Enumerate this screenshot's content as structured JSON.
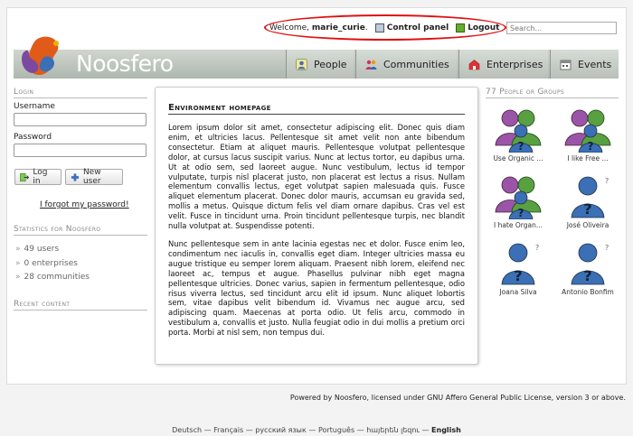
{
  "userbar": {
    "welcome_prefix": "Welcome,",
    "username": "marie_curie",
    "control_panel": "Control panel",
    "logout": "Logout"
  },
  "search": {
    "placeholder": "Search..."
  },
  "site": {
    "name": "Noosfero"
  },
  "nav": {
    "people": "People",
    "communities": "Communities",
    "enterprises": "Enterprises",
    "events": "Events"
  },
  "login": {
    "title": "Login",
    "username_label": "Username",
    "password_label": "Password",
    "login_button": "Log in",
    "new_user_button": "New user",
    "forgot": "I forgot my password!"
  },
  "statistics": {
    "title": "Statistics for Noosfero",
    "items": [
      "49 users",
      "0 enterprises",
      "28 communities"
    ]
  },
  "recent": {
    "title": "Recent content"
  },
  "main": {
    "title": "Environment homepage",
    "p1": "Lorem ipsum dolor sit amet, consectetur adipiscing elit. Donec quis diam enim, et ultricies lacus. Pellentesque sit amet velit non ante bibendum consectetur. Etiam at aliquet mauris. Pellentesque volutpat pellentesque dolor, at cursus lacus suscipit varius. Nunc at lectus tortor, eu dapibus urna. Ut at odio sem, sed laoreet augue. Nunc vestibulum, lectus id tempor vulputate, turpis nisl placerat justo, non placerat est lectus a risus. Nullam elementum convallis lectus, eget volutpat sapien malesuada quis. Fusce aliquet elementum placerat. Donec dolor mauris, accumsan eu gravida sed, mollis a metus. Quisque dictum felis vel diam ornare dapibus. Cras vel est velit. Fusce in tincidunt urna. Proin tincidunt pellentesque turpis, nec blandit nulla volutpat at. Suspendisse potenti.",
    "p2": "Nunc pellentesque sem in ante lacinia egestas nec et dolor. Fusce enim leo, condimentum nec iaculis in, convallis eget diam. Integer ultricies massa eu augue tristique eu semper lorem aliquam. Praesent nibh lorem, eleifend nec laoreet ac, tempus et augue. Phasellus pulvinar nibh eget magna pellentesque ultricies. Donec varius, sapien in fermentum pellentesque, odio risus viverra lectus, sed tincidunt arcu elit id ipsum. Nunc aliquet lobortis sem, vitae dapibus velit bibendum id. Vivamus nec augue arcu, sed adipiscing quam. Maecenas at porta odio. Ut felis arcu, commodo in vestibulum a, convallis et justo. Nulla feugiat odio in dui mollis a pretium orci porta. Morbi at nisl sem, non tempus dui."
  },
  "people": {
    "title": "77 People or Groups",
    "items": [
      {
        "name": "Use Organic ...",
        "kind": "group"
      },
      {
        "name": "I like Free ...",
        "kind": "group"
      },
      {
        "name": "I hate Organ...",
        "kind": "group"
      },
      {
        "name": "José Oliveira",
        "kind": "person"
      },
      {
        "name": "Joana Silva",
        "kind": "person"
      },
      {
        "name": "Antonio Bonfim",
        "kind": "person"
      }
    ]
  },
  "footer": {
    "powered_prefix": "Powered by",
    "noosfero": "Noosfero",
    "licensed": ", licensed under",
    "license": "GNU Affero General Public License",
    "suffix": ", version 3 or above.",
    "languages": [
      "Deutsch",
      "Français",
      "русский язык",
      "Português",
      "հայերեն լեզու"
    ],
    "current_language": "English",
    "separator": " — "
  },
  "colors": {
    "highlight_oval": "#e01010",
    "banner": "#b8c0b8",
    "person_blue": "#3b6fb6",
    "group_purple": "#9a55a8",
    "group_green": "#58a040"
  }
}
